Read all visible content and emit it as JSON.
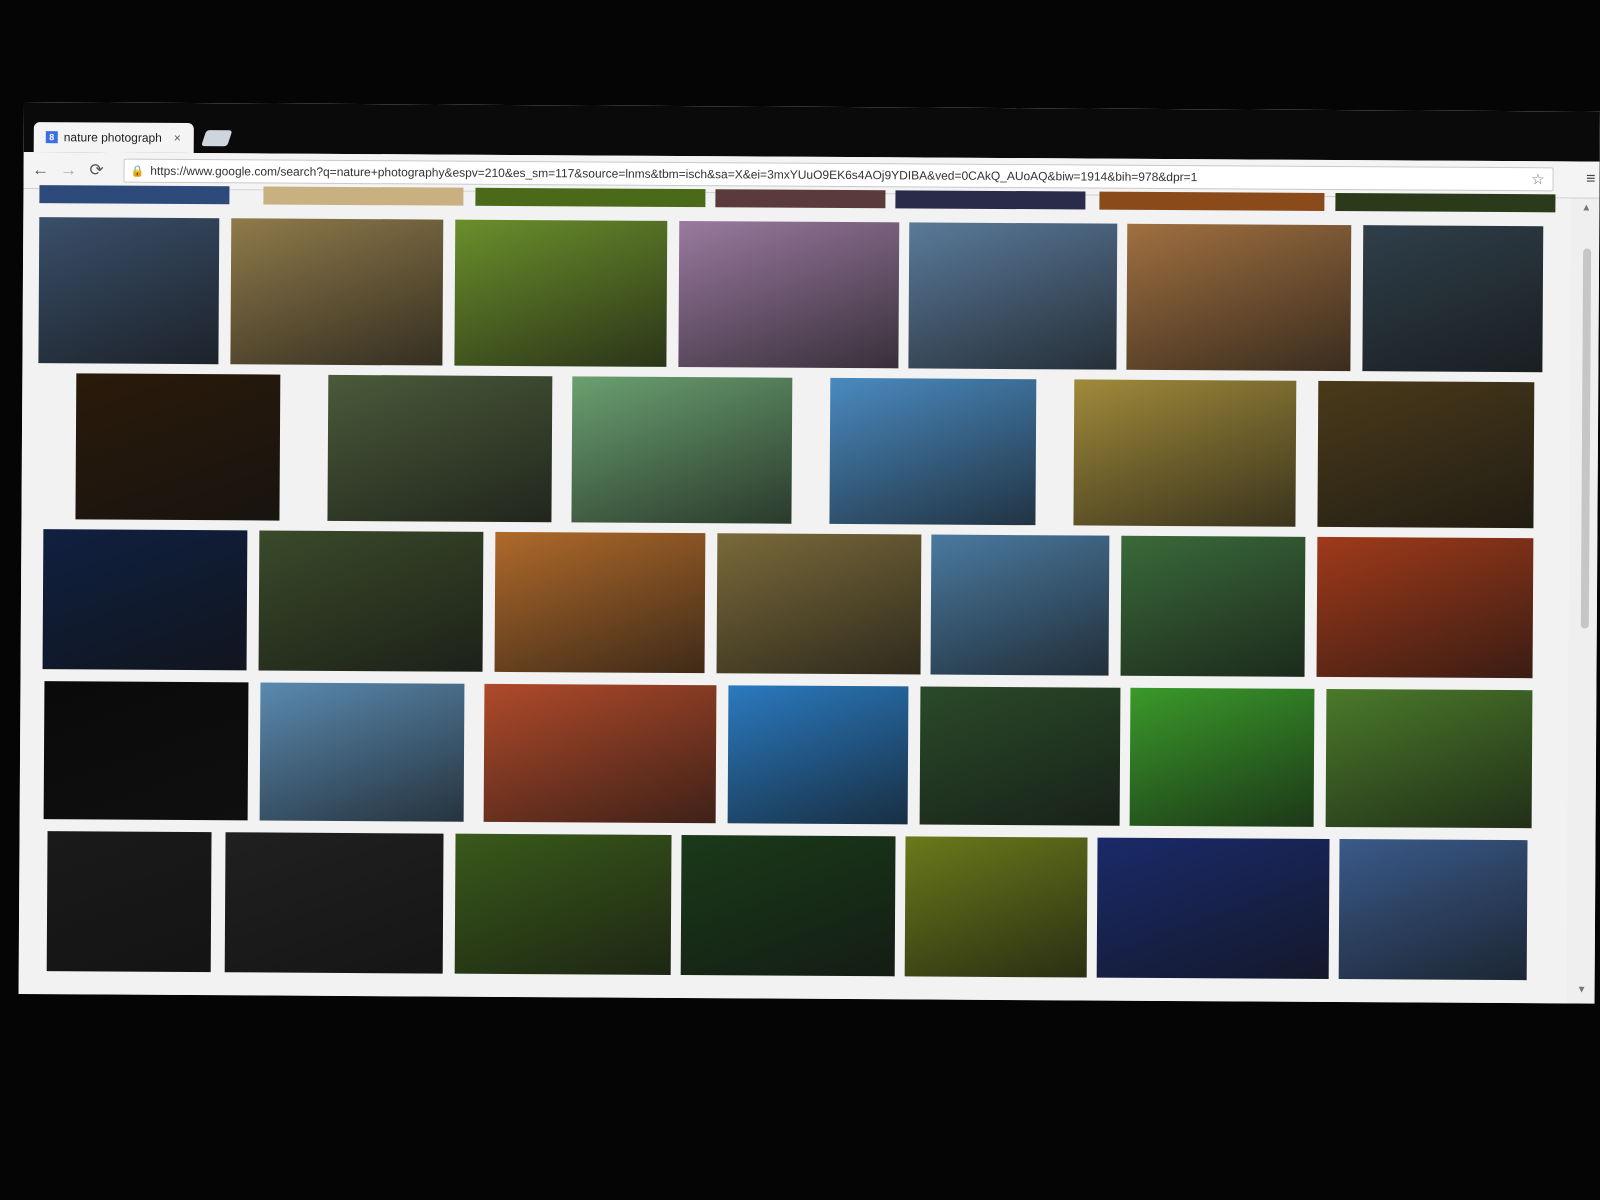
{
  "browser": {
    "tab_title": "nature photograph",
    "tab_close": "×",
    "url_lock": "🔒",
    "url": "https://www.google.com/search?q=nature+photography&espv=210&es_sm=117&source=lnms&tbm=isch&sa=X&ei=3mxYUuO9EK6s4AOj9YDIBA&ved=0CAkQ_AUoAQ&biw=1914&bih=978&dpr=1",
    "back": "←",
    "forward": "→",
    "reload": "⟳",
    "star": "☆",
    "menu": "≡",
    "favicon": "8"
  },
  "results": {
    "count": 39,
    "palette": [
      "#3a4f6a",
      "#8f7a4a",
      "#6b8f2b",
      "#9a7aa0",
      "#5a7a9a",
      "#a07040",
      "#2f3f4a",
      "#2a1a0a",
      "#4a5a3a",
      "#6aa070",
      "#4a8ac0",
      "#a08a3a",
      "#4a3a1a",
      "#102040",
      "#3a4a2a",
      "#b06a2a",
      "#7a6a3a",
      "#4a7aa0",
      "#3a6a3a",
      "#a03a1a",
      "#0a0a0a",
      "#5a8ab0",
      "#b04a2a",
      "#2a7ac0",
      "#2a4a2a",
      "#3a9a2a",
      "#4a7a2a",
      "#1a1a1a",
      "#202020",
      "#3a5a1a",
      "#1a3a1a",
      "#6a7a1a",
      "#1a2a6a",
      "#3a5a8a",
      "#2a2a1a",
      "#8a3a1a",
      "#3a7a2a",
      "#2a2a0a",
      "#3a6a1a"
    ]
  },
  "scrollbar": {
    "up": "▲",
    "down": "▼"
  }
}
